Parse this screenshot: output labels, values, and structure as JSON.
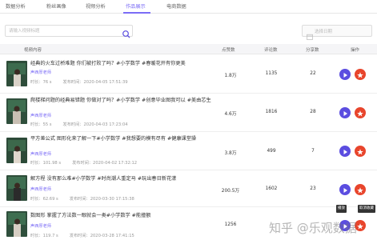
{
  "colors": {
    "accent": "#7b6cf6",
    "play": "#5b4de0",
    "favorite": "#e8452c"
  },
  "tabs": [
    {
      "label": "数据分析"
    },
    {
      "label": "粉丝画像"
    },
    {
      "label": "视频分析"
    },
    {
      "label": "作品展示"
    },
    {
      "label": "电商数据"
    }
  ],
  "active_tab": "作品展示",
  "search": {
    "placeholder": "请输入视频标题",
    "icon": "search-icon"
  },
  "date_filter": {
    "placeholder": "选择日期",
    "icon": "calendar-icon"
  },
  "table": {
    "headers": {
      "content": "视频内容",
      "likes": "点赞数",
      "comments": "评论数",
      "shares": "分享数",
      "actions": "操作"
    },
    "rows": [
      {
        "title": "经典的火车过桥难题 你们被打败了吗？#小学数学 #春暖花开有你更美",
        "author": "声西厚老师",
        "duration": "时长：76 s",
        "published": "发布时间：2020-04-05 17:51:39",
        "likes": "1.8万",
        "comments": "1135",
        "shares": "22"
      },
      {
        "title": "爬楼梯问题的经典易错题 你做对了吗？#小学数学 #创意毕业图我可以 #美由芯生",
        "author": "声西厚老师",
        "duration": "时长：55 s",
        "published": "发布时间：2020-04-03 17:23:04",
        "likes": "4.6万",
        "comments": "1816",
        "shares": "28"
      },
      {
        "title": "平方差公式 图形化来了解一下#小学数学 #我想要的模有尽有 #健康课堂操",
        "author": "声西厚老师",
        "duration": "时长：101.98 s",
        "published": "发布时间：2020-04-02 17:32:12",
        "likes": "3.8万",
        "comments": "499",
        "shares": "7"
      },
      {
        "title": "解方程 没有那么难#小学数学 #时尚潮人重定马 #玩出春日新花漾",
        "author": "声西厚老师",
        "duration": "时长：62.69 s",
        "published": "发布时间：2020-03-30 17:15:38",
        "likes": "200.5万",
        "comments": "1602",
        "shares": "23"
      },
      {
        "title": "数图形 掌握了方法数一眼就会一类#小学数学 #能撞额",
        "author": "声西厚老师",
        "duration": "时长：119.7 s",
        "published": "发布时间：2020-03-28 17:41:15",
        "likes": "1256",
        "comments": "",
        "shares": ""
      }
    ]
  },
  "tooltips": {
    "play": "播放",
    "favorite": "取消收藏"
  },
  "watermark": "知乎 @乐观数据"
}
